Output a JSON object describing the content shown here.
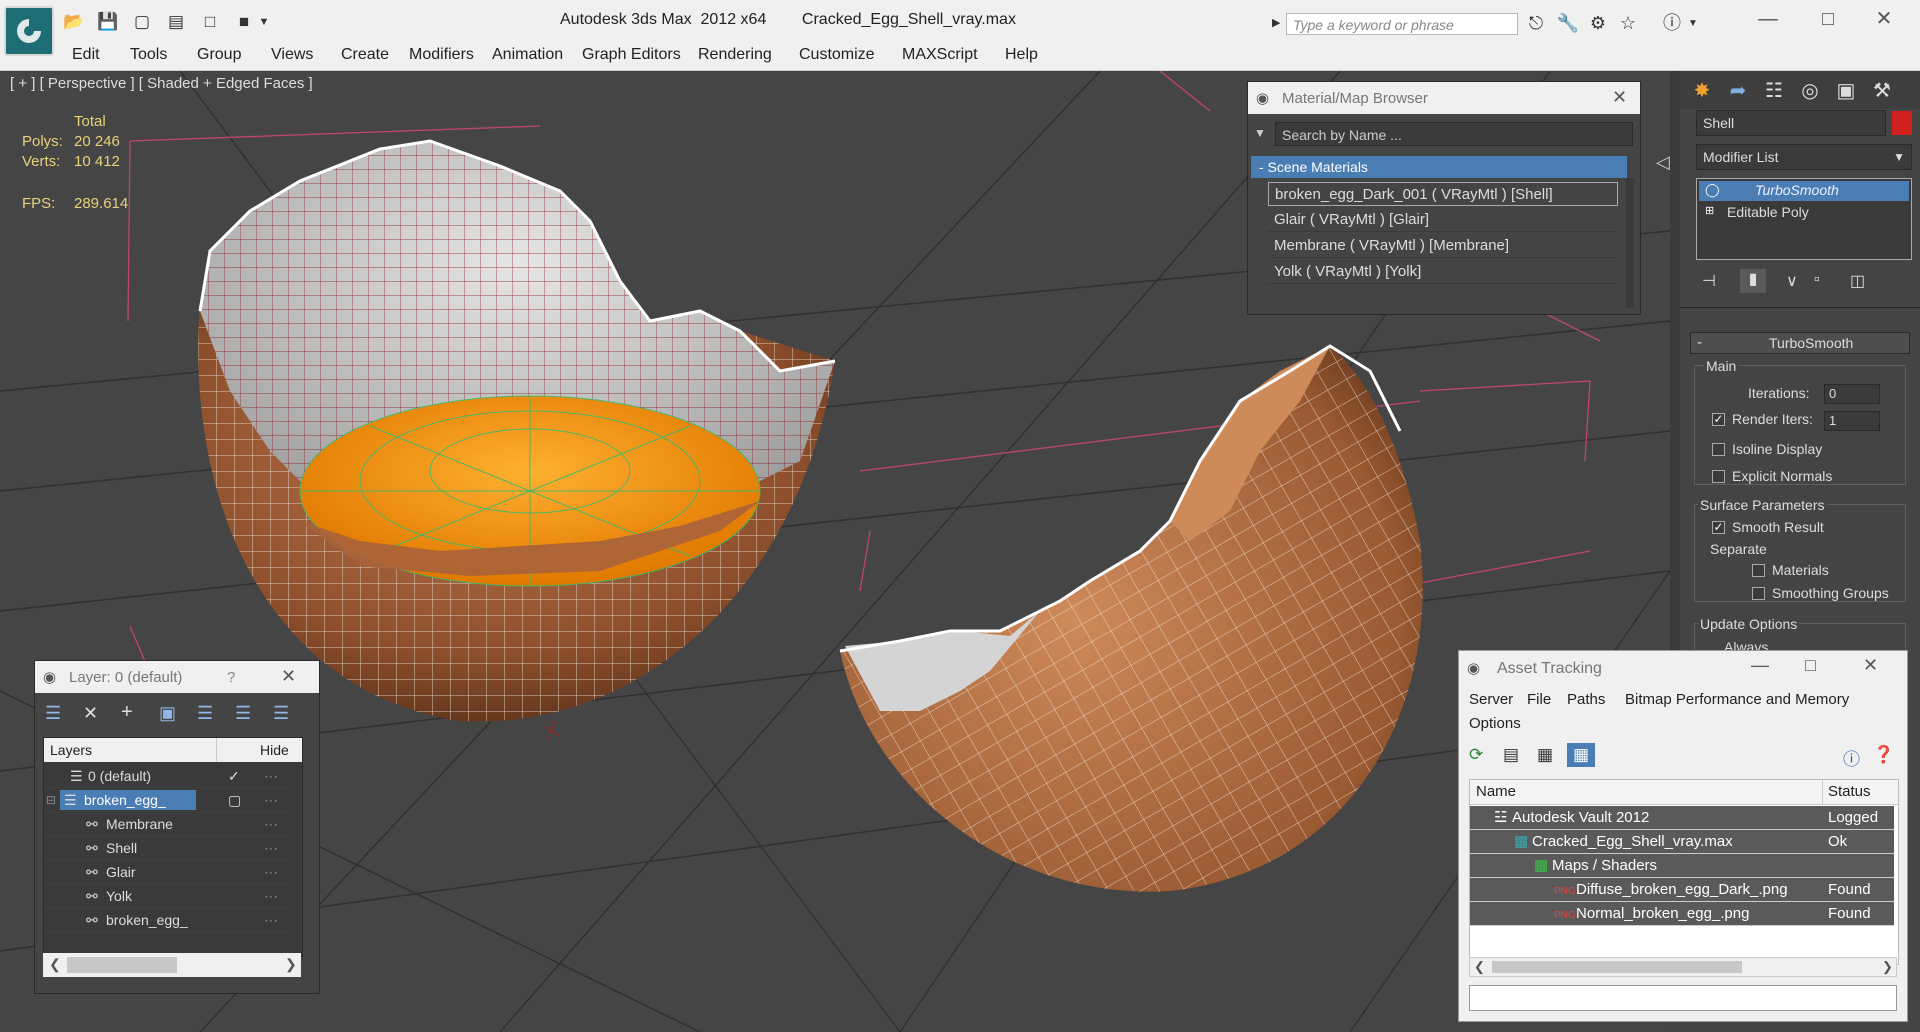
{
  "window": {
    "title": "Autodesk 3ds Max  2012 x64        Cracked_Egg_Shell_vray.max",
    "search_placeholder": "Type a keyword or phrase"
  },
  "menu": [
    "Edit",
    "Tools",
    "Group",
    "Views",
    "Create",
    "Modifiers",
    "Animation",
    "Graph Editors",
    "Rendering",
    "Customize",
    "MAXScript",
    "Help"
  ],
  "viewport": {
    "label": "[ + ] [ Perspective ] [ Shaded + Edged Faces ]",
    "stats": {
      "total_label": "Total",
      "polys_label": "Polys:",
      "polys_value": "20 246",
      "verts_label": "Verts:",
      "verts_value": "10 412",
      "fps_label": "FPS:",
      "fps_value": "289.614"
    }
  },
  "material_browser": {
    "title": "Material/Map Browser",
    "search_placeholder": "Search by Name ...",
    "group_label": "- Scene Materials",
    "materials": [
      "broken_egg_Dark_001  ( VRayMtl )  [Shell]",
      "Glair  ( VRayMtl )  [Glair]",
      "Membrane  ( VRayMtl )  [Membrane]",
      "Yolk  ( VRayMtl )  [Yolk]"
    ]
  },
  "command_panel": {
    "object_name": "Shell",
    "object_color": "#d02020",
    "modifier_list_label": "Modifier List",
    "stack": [
      "TurboSmooth",
      "Editable Poly"
    ],
    "rollout_title": "TurboSmooth",
    "main_group": "Main",
    "iterations_label": "Iterations:",
    "iterations_value": "0",
    "render_iters_label": "Render Iters:",
    "render_iters_value": "1",
    "isoline_label": "Isoline Display",
    "explicit_normals_label": "Explicit Normals",
    "surface_params_group": "Surface Parameters",
    "smooth_result_label": "Smooth Result",
    "separate_label": "Separate",
    "materials_label": "Materials",
    "smoothing_groups_label": "Smoothing Groups",
    "update_options_group": "Update Options",
    "always_label": "Always"
  },
  "layer_window": {
    "title": "Layer: 0 (default)",
    "help": "?",
    "col_layers": "Layers",
    "col_hide": "Hide",
    "rows": [
      {
        "name": "0 (default)",
        "indent": 0
      },
      {
        "name": "broken_egg_",
        "indent": 0
      },
      {
        "name": "Membrane",
        "indent": 1
      },
      {
        "name": "Shell",
        "indent": 1
      },
      {
        "name": "Glair",
        "indent": 1
      },
      {
        "name": "Yolk",
        "indent": 1
      },
      {
        "name": "broken_egg_",
        "indent": 1
      }
    ]
  },
  "asset_tracking": {
    "title": "Asset Tracking",
    "menu": [
      "Server",
      "File",
      "Paths",
      "Bitmap Performance and Memory",
      "Options"
    ],
    "col_name": "Name",
    "col_status": "Status",
    "rows": [
      {
        "name": "Autodesk Vault 2012",
        "status": "Logged Ou"
      },
      {
        "name": "Cracked_Egg_Shell_vray.max",
        "status": "Ok"
      },
      {
        "name": "Maps / Shaders",
        "status": ""
      },
      {
        "name": "Diffuse_broken_egg_Dark_.png",
        "status": "Found"
      },
      {
        "name": "Normal_broken_egg_.png",
        "status": "Found"
      }
    ]
  }
}
